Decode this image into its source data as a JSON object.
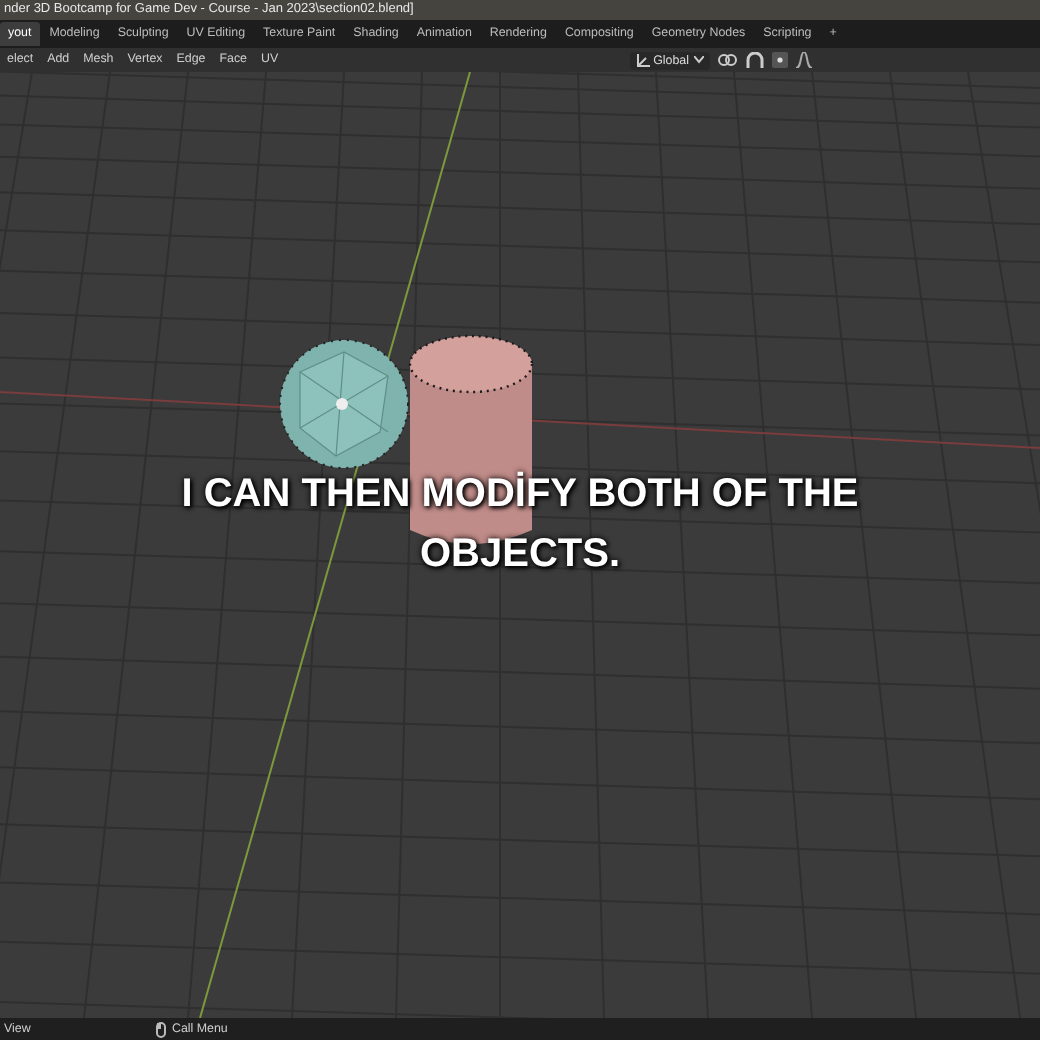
{
  "window": {
    "title": "nder 3D Bootcamp for Game Dev - Course - Jan 2023\\section02.blend]"
  },
  "workspace_tabs": [
    {
      "label": "yout",
      "selected": true
    },
    {
      "label": "Modeling",
      "selected": false
    },
    {
      "label": "Sculpting",
      "selected": false
    },
    {
      "label": "UV Editing",
      "selected": false
    },
    {
      "label": "Texture Paint",
      "selected": false
    },
    {
      "label": "Shading",
      "selected": false
    },
    {
      "label": "Animation",
      "selected": false
    },
    {
      "label": "Rendering",
      "selected": false
    },
    {
      "label": "Compositing",
      "selected": false
    },
    {
      "label": "Geometry Nodes",
      "selected": false
    },
    {
      "label": "Scripting",
      "selected": false
    }
  ],
  "add_tab": "+",
  "header": {
    "menus": [
      "elect",
      "Add",
      "Mesh",
      "Vertex",
      "Edge",
      "Face",
      "UV"
    ],
    "orientation": "Global"
  },
  "caption": "I CAN THEN MODİFY BOTH OF THE OBJECTS.",
  "status_bar": {
    "left": "View",
    "hint": "Call Menu"
  }
}
